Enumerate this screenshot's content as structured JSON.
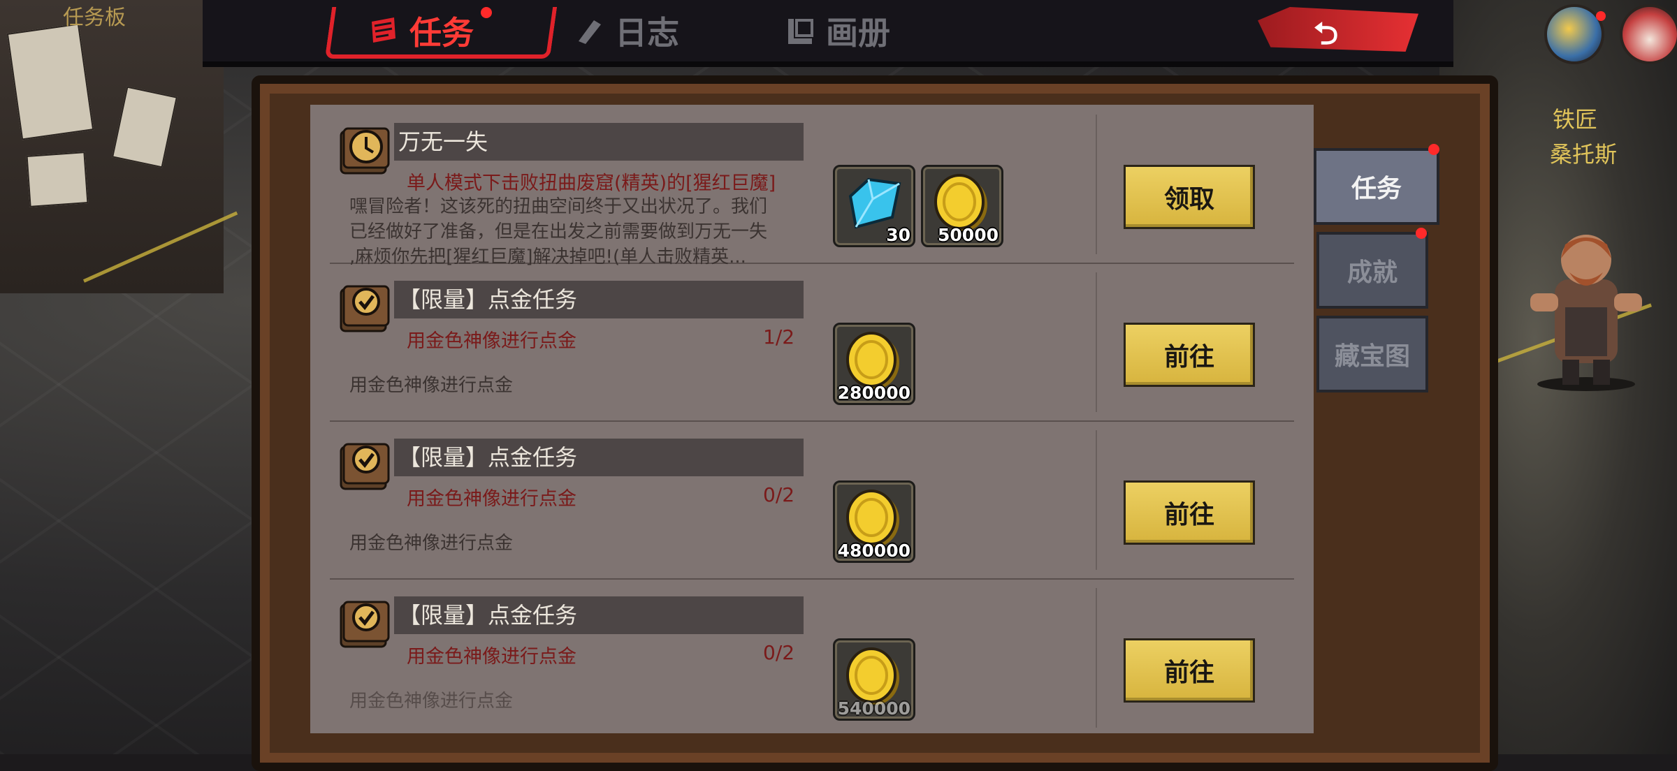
{
  "top_label": "任务板",
  "tabs": [
    {
      "label": "任务",
      "active": true
    },
    {
      "label": "日志",
      "active": false
    },
    {
      "label": "画册",
      "active": false
    }
  ],
  "side_tabs": [
    {
      "label": "任务",
      "active": true
    },
    {
      "label": "成就",
      "active": false
    },
    {
      "label": "藏宝图",
      "active": false
    }
  ],
  "npc": {
    "title": "铁匠",
    "name": "桑托斯"
  },
  "quests": [
    {
      "title": "万无一失",
      "requirement": "单人模式下击败扭曲废窟(精英)的[猩红巨魔]",
      "progress": "",
      "description": [
        "嘿冒险者！这该死的扭曲空间终于又出状况了。我们",
        "已经做好了准备，但是在出发之前需要做到万无一失",
        ",麻烦你先把[猩红巨魔]解决掉吧!(单人击败精英..."
      ],
      "rewards": [
        {
          "icon": "diamond-icon",
          "amount": "30"
        },
        {
          "icon": "gold-coin-icon",
          "amount": "50000"
        }
      ],
      "button": "领取"
    },
    {
      "title": "【限量】点金任务",
      "requirement": "用金色神像进行点金",
      "progress": "1/2",
      "description": [
        "用金色神像进行点金"
      ],
      "rewards": [
        {
          "icon": "gold-coin-icon",
          "amount": "280000"
        }
      ],
      "button": "前往"
    },
    {
      "title": "【限量】点金任务",
      "requirement": "用金色神像进行点金",
      "progress": "0/2",
      "description": [
        "用金色神像进行点金"
      ],
      "rewards": [
        {
          "icon": "gold-coin-icon",
          "amount": "480000"
        }
      ],
      "button": "前往"
    },
    {
      "title": "【限量】点金任务",
      "requirement": "用金色神像进行点金",
      "progress": "0/2",
      "description": [
        "用金色神像进行点金"
      ],
      "rewards": [
        {
          "icon": "gold-coin-icon",
          "amount": "540000"
        }
      ],
      "button": "前往"
    }
  ],
  "colors": {
    "accent_red": "#e0222a",
    "button_gold": "#e3c452",
    "panel": "#7f7472"
  }
}
